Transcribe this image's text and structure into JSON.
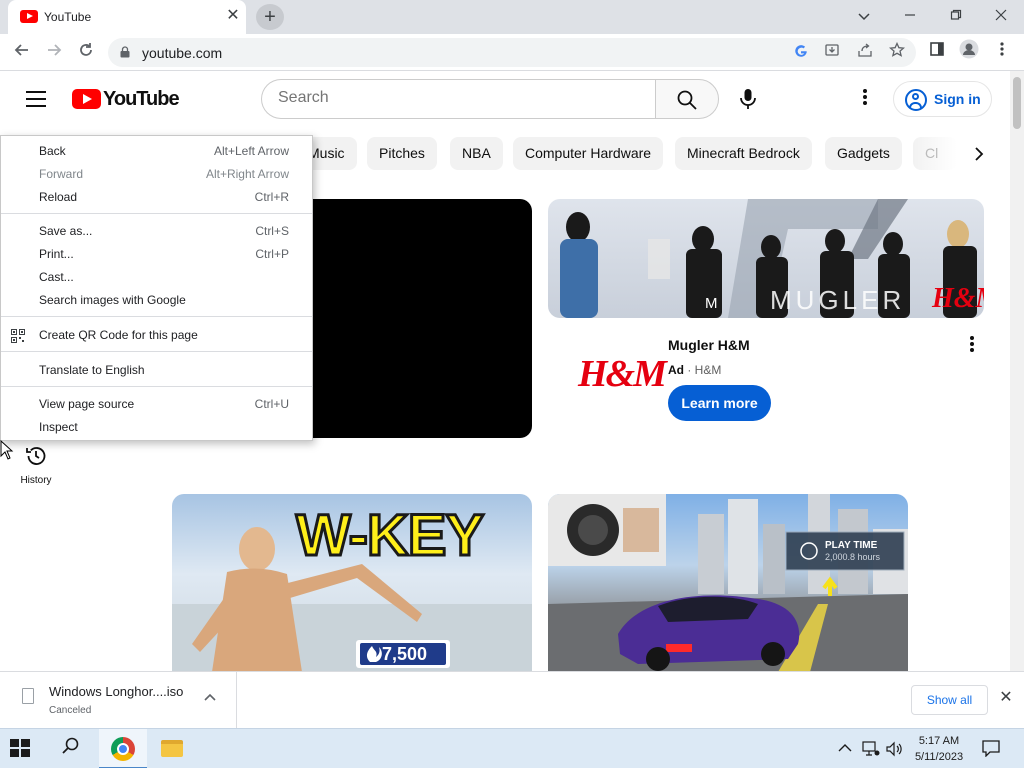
{
  "browser": {
    "tab_title": "YouTube",
    "url": "youtube.com",
    "tab_close": "✕",
    "new_tab": "+"
  },
  "youtube": {
    "logo_text": "YouTube",
    "search_placeholder": "Search",
    "sign_in_label": "Sign in",
    "chips": [
      {
        "label": "Music"
      },
      {
        "label": "Pitches"
      },
      {
        "label": "NBA"
      },
      {
        "label": "Computer Hardware"
      },
      {
        "label": "Minecraft Bedrock"
      },
      {
        "label": "Gadgets"
      },
      {
        "label": "Cl"
      }
    ],
    "guide": {
      "history_label": "History"
    },
    "ad": {
      "logo": "H&M",
      "title": "Mugler H&M",
      "ad_badge": "Ad",
      "advertiser": "H&M",
      "cta": "Learn more",
      "banner_text_left": "M",
      "banner_text": "MUGLER",
      "banner_text_brand": "H&M"
    },
    "thumbnails": {
      "wkey_title": "W-KEY",
      "wkey_badge": "7,500",
      "playtime_label": "PLAY TIME",
      "playtime_hours": "2,000.8 hours"
    }
  },
  "context_menu": {
    "items": [
      {
        "label": "Back",
        "shortcut": "Alt+Left Arrow",
        "disabled": false
      },
      {
        "label": "Forward",
        "shortcut": "Alt+Right Arrow",
        "disabled": true
      },
      {
        "label": "Reload",
        "shortcut": "Ctrl+R",
        "disabled": false
      },
      {
        "label": "Save as...",
        "shortcut": "Ctrl+S",
        "disabled": false
      },
      {
        "label": "Print...",
        "shortcut": "Ctrl+P",
        "disabled": false
      },
      {
        "label": "Cast...",
        "shortcut": "",
        "disabled": false
      },
      {
        "label": "Search images with Google",
        "shortcut": "",
        "disabled": false
      },
      {
        "label": "Create QR Code for this page",
        "shortcut": "",
        "disabled": false
      },
      {
        "label": "Translate to English",
        "shortcut": "",
        "disabled": false
      },
      {
        "label": "View page source",
        "shortcut": "Ctrl+U",
        "disabled": false
      },
      {
        "label": "Inspect",
        "shortcut": "",
        "disabled": false
      }
    ]
  },
  "downloads": {
    "file_name": "Windows Longhor....iso",
    "status": "Canceled",
    "show_all_label": "Show all",
    "close": "✕"
  },
  "taskbar": {
    "time": "5:17 AM",
    "date": "5/11/2023"
  },
  "colors": {
    "youtube_red": "#ff0000",
    "link_blue": "#065fd4",
    "hm_red": "#e50010",
    "chip_bg": "#f2f2f2"
  }
}
